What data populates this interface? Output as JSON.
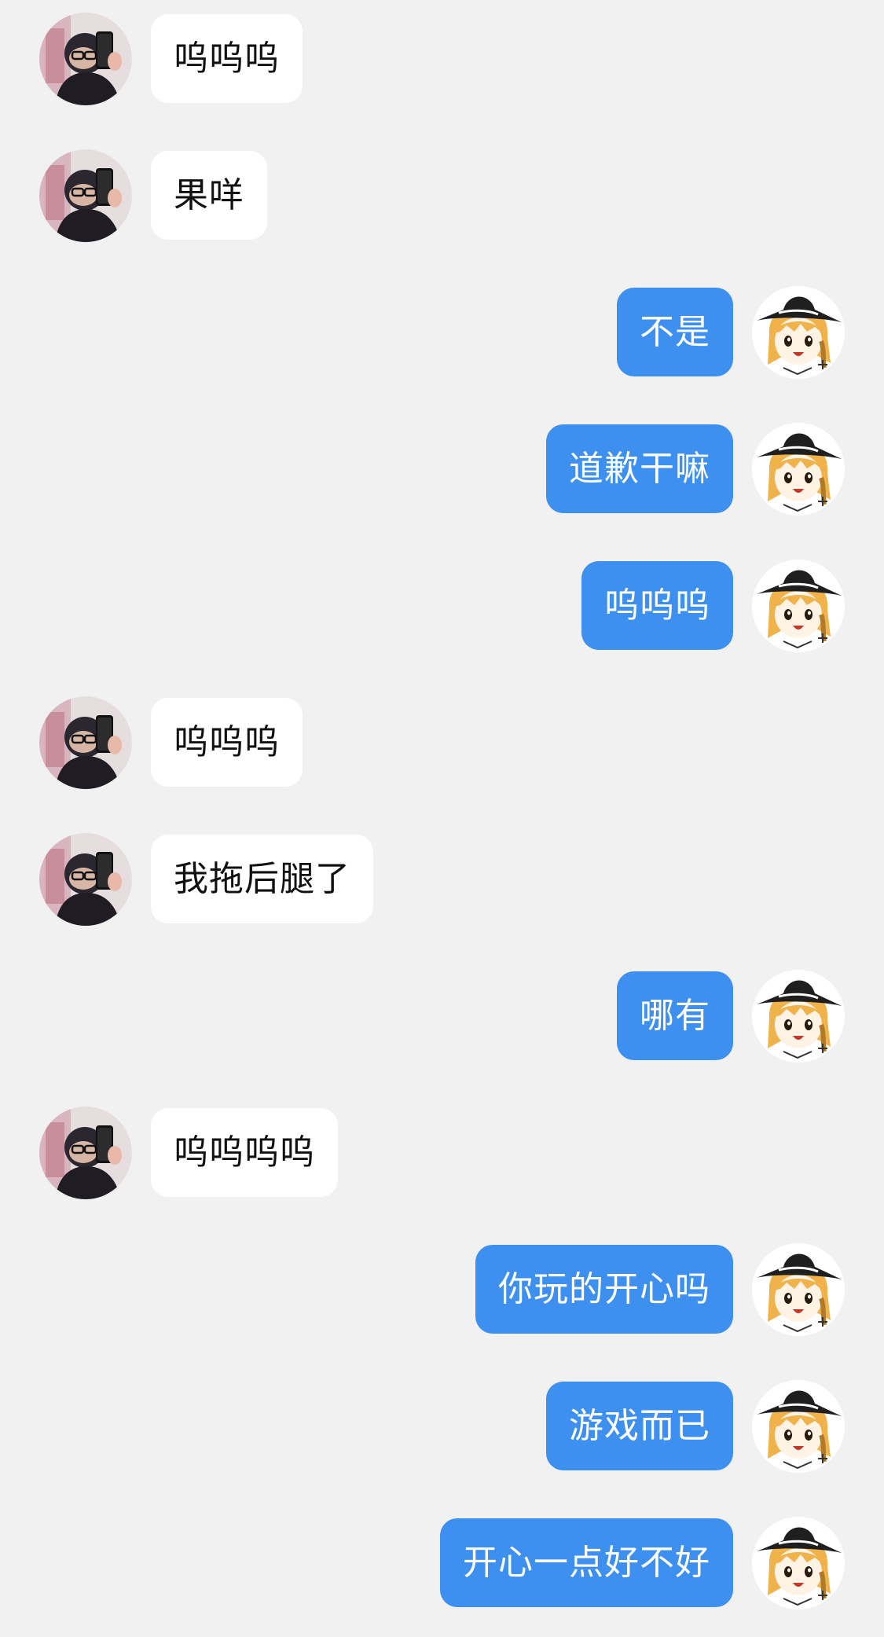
{
  "colors": {
    "background": "#f1f1f1",
    "incoming_bubble": "#ffffff",
    "outgoing_bubble": "#3d8ff0",
    "incoming_text": "#111111",
    "outgoing_text": "#ffffff"
  },
  "messages": [
    {
      "side": "left",
      "text": "呜呜呜"
    },
    {
      "side": "left",
      "text": "果咩"
    },
    {
      "side": "right",
      "text": "不是"
    },
    {
      "side": "right",
      "text": "道歉干嘛"
    },
    {
      "side": "right",
      "text": "呜呜呜"
    },
    {
      "side": "left",
      "text": "呜呜呜"
    },
    {
      "side": "left",
      "text": "我拖后腿了"
    },
    {
      "side": "right",
      "text": "哪有"
    },
    {
      "side": "left",
      "text": "呜呜呜呜"
    },
    {
      "side": "right",
      "text": "你玩的开心吗"
    },
    {
      "side": "right",
      "text": "游戏而已"
    },
    {
      "side": "right",
      "text": "开心一点好不好"
    }
  ]
}
